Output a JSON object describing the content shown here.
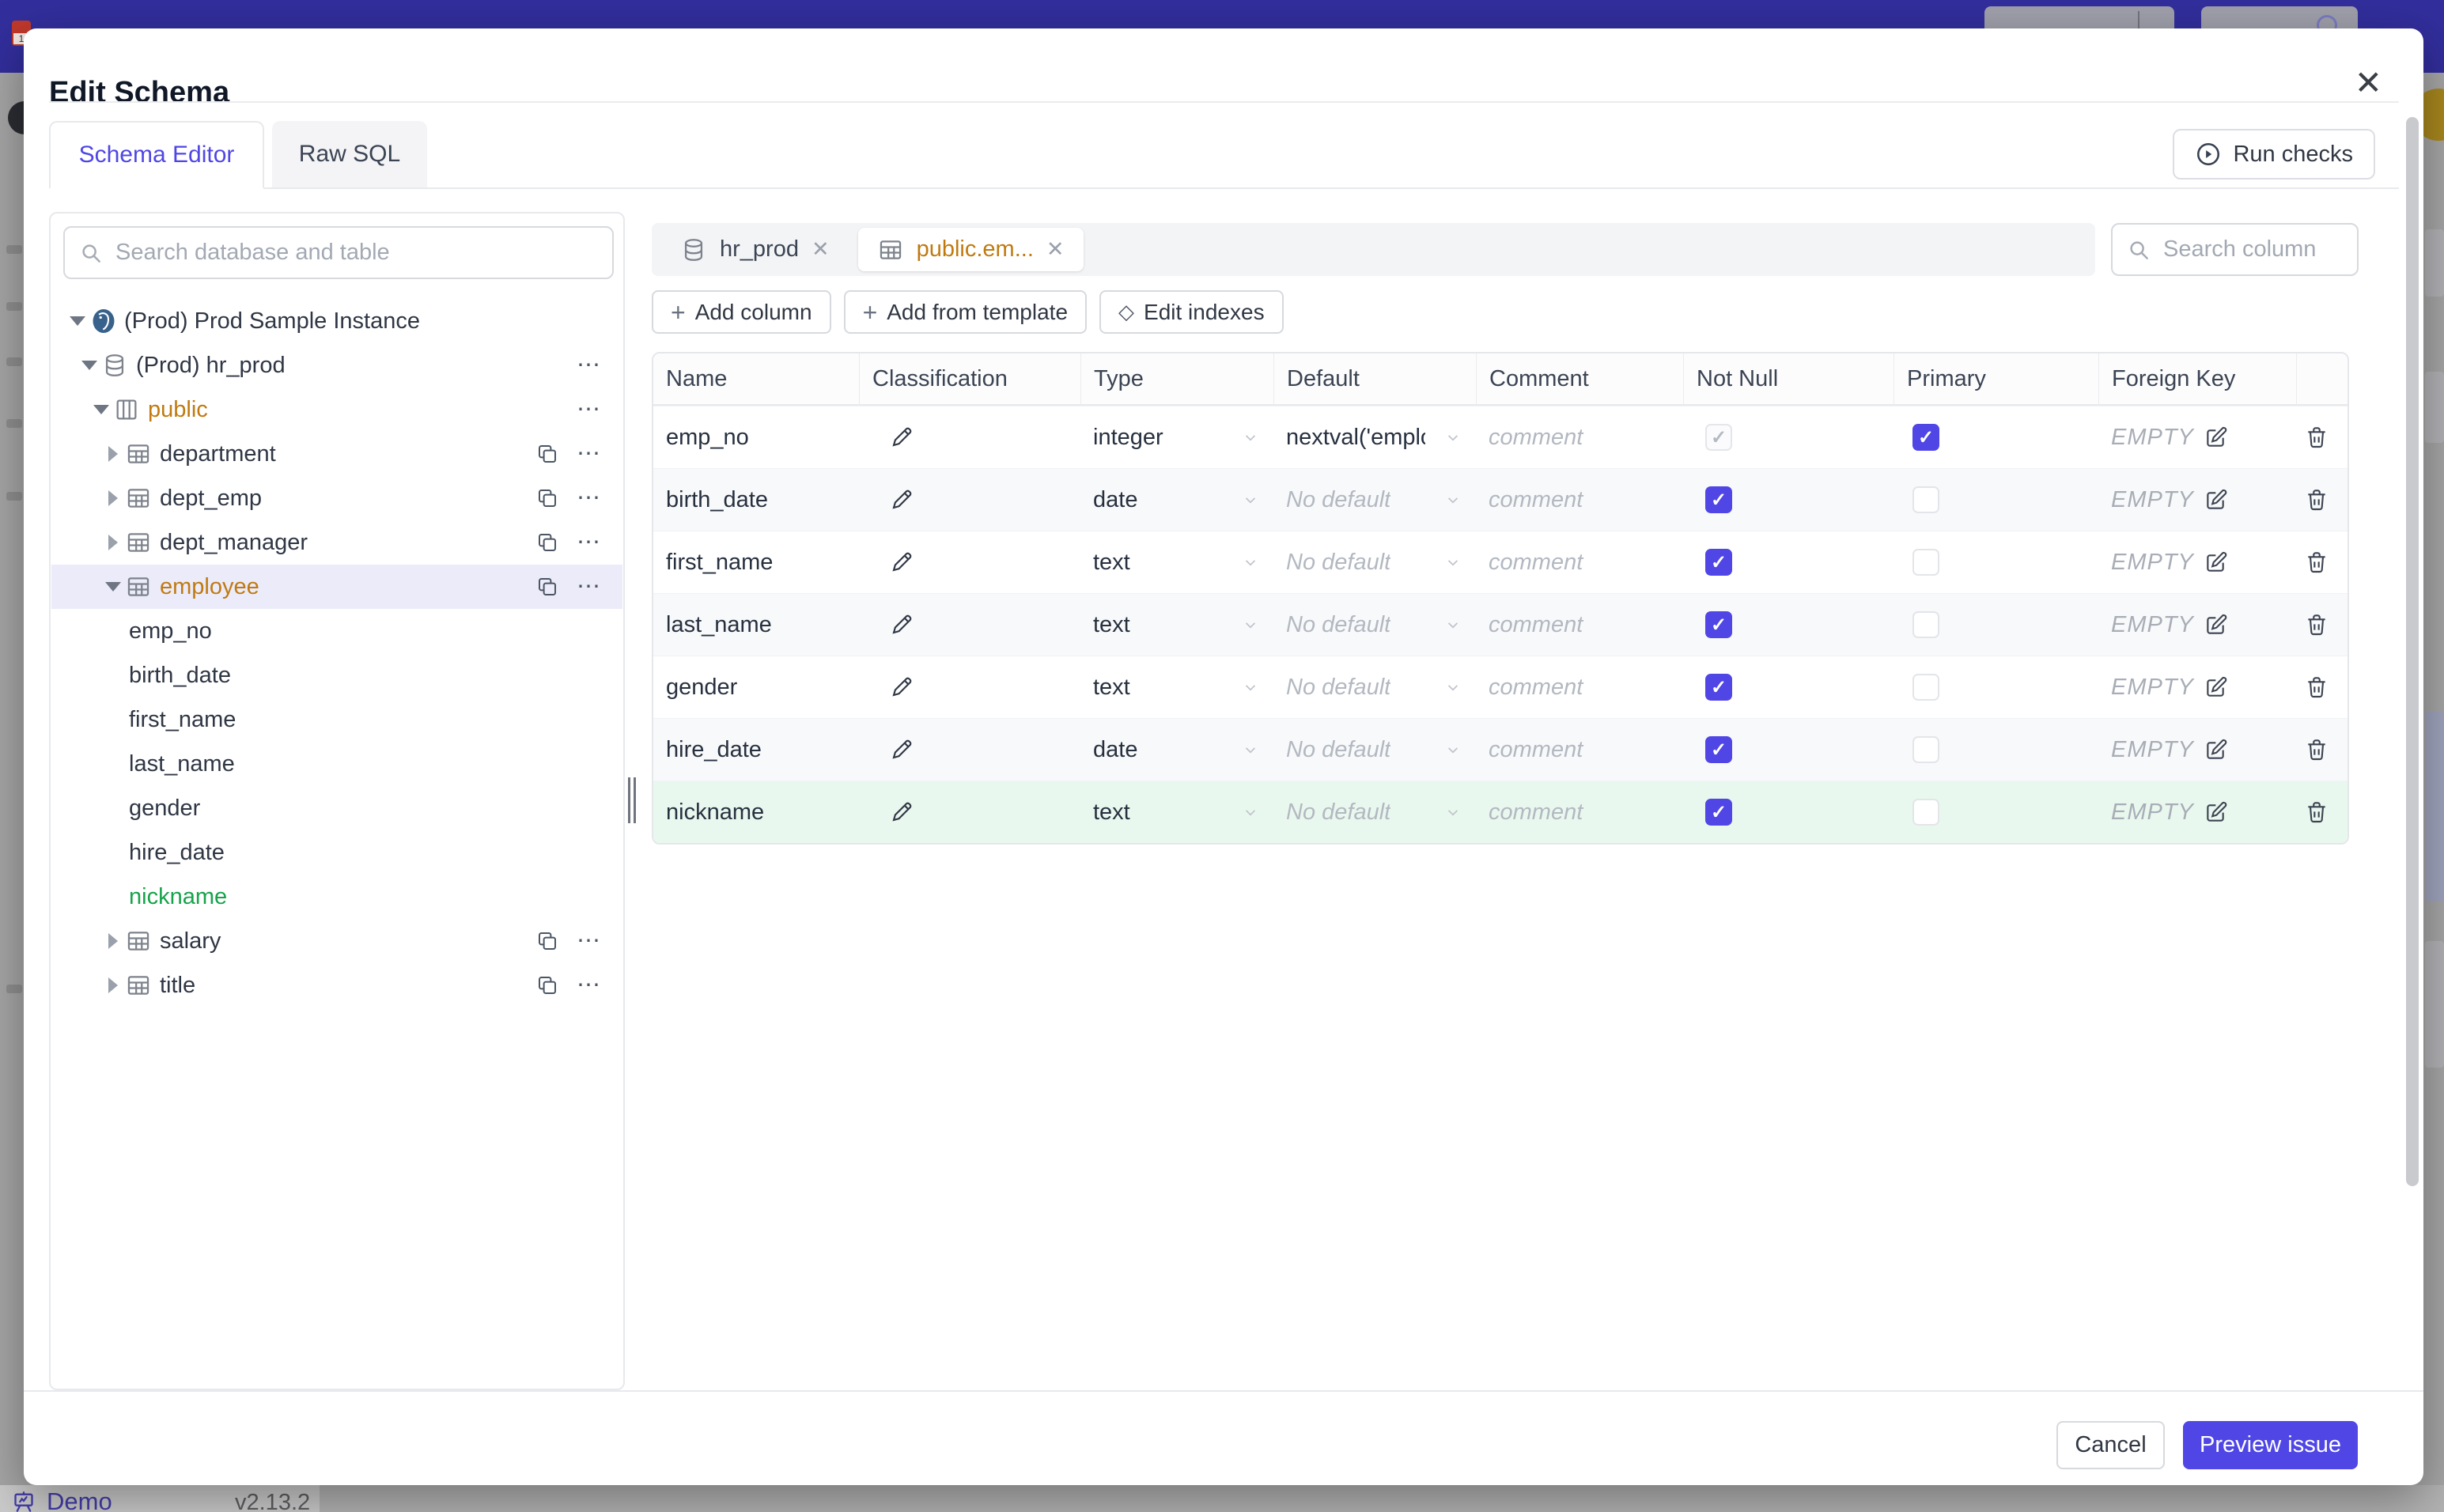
{
  "backdrop": {
    "footer": {
      "demo_label": "Demo",
      "version": "v2.13.2"
    }
  },
  "modal": {
    "title": "Edit Schema",
    "close_icon": "✕",
    "tabs": [
      {
        "label": "Schema Editor",
        "active": true
      },
      {
        "label": "Raw SQL",
        "active": false
      }
    ],
    "run_checks_label": "Run checks"
  },
  "sidebar": {
    "search_placeholder": "Search database and table",
    "tree": [
      {
        "level": 0,
        "label": "(Prod) Prod Sample Instance",
        "icon": "postgresql",
        "expanded": true,
        "actions": []
      },
      {
        "level": 1,
        "label": "(Prod) hr_prod",
        "icon": "database",
        "expanded": true,
        "actions": [
          "more"
        ]
      },
      {
        "level": 2,
        "label": "public",
        "icon": "schema",
        "expanded": true,
        "color": "amber",
        "actions": [
          "more"
        ]
      },
      {
        "level": 3,
        "label": "department",
        "icon": "table",
        "expanded": false,
        "actions": [
          "copy",
          "more"
        ]
      },
      {
        "level": 3,
        "label": "dept_emp",
        "icon": "table",
        "expanded": false,
        "actions": [
          "copy",
          "more"
        ]
      },
      {
        "level": 3,
        "label": "dept_manager",
        "icon": "table",
        "expanded": false,
        "actions": [
          "copy",
          "more"
        ]
      },
      {
        "level": 3,
        "label": "employee",
        "icon": "table",
        "expanded": true,
        "selected": true,
        "color": "amber",
        "actions": [
          "copy",
          "more"
        ]
      },
      {
        "level": 4,
        "label": "emp_no",
        "leaf": true
      },
      {
        "level": 4,
        "label": "birth_date",
        "leaf": true
      },
      {
        "level": 4,
        "label": "first_name",
        "leaf": true
      },
      {
        "level": 4,
        "label": "last_name",
        "leaf": true
      },
      {
        "level": 4,
        "label": "gender",
        "leaf": true
      },
      {
        "level": 4,
        "label": "hire_date",
        "leaf": true
      },
      {
        "level": 4,
        "label": "nickname",
        "leaf": true,
        "color": "green"
      },
      {
        "level": 3,
        "label": "salary",
        "icon": "table",
        "expanded": false,
        "actions": [
          "copy",
          "more"
        ]
      },
      {
        "level": 3,
        "label": "title",
        "icon": "table",
        "expanded": false,
        "actions": [
          "copy",
          "more"
        ]
      }
    ]
  },
  "main": {
    "tabs": [
      {
        "label": "hr_prod",
        "icon": "database",
        "active": false
      },
      {
        "label": "public.em...",
        "icon": "table",
        "active": true
      }
    ],
    "toolbar": [
      {
        "label": "Add column",
        "icon": "plus"
      },
      {
        "label": "Add from template",
        "icon": "plus"
      },
      {
        "label": "Edit indexes",
        "icon": "diamond"
      }
    ],
    "search_placeholder": "Search column",
    "table": {
      "headers": [
        "Name",
        "Classification",
        "Type",
        "Default",
        "Comment",
        "Not Null",
        "Primary",
        "Foreign Key",
        ""
      ],
      "comment_placeholder": "comment",
      "foreign_key_empty": "EMPTY",
      "rows": [
        {
          "name": "emp_no",
          "type": "integer",
          "default": "nextval('employ",
          "default_is_placeholder": false,
          "not_null": true,
          "not_null_disabled": true,
          "primary": true,
          "new": false
        },
        {
          "name": "birth_date",
          "type": "date",
          "default": "No default",
          "default_is_placeholder": true,
          "not_null": true,
          "not_null_disabled": false,
          "primary": false,
          "new": false
        },
        {
          "name": "first_name",
          "type": "text",
          "default": "No default",
          "default_is_placeholder": true,
          "not_null": true,
          "not_null_disabled": false,
          "primary": false,
          "new": false
        },
        {
          "name": "last_name",
          "type": "text",
          "default": "No default",
          "default_is_placeholder": true,
          "not_null": true,
          "not_null_disabled": false,
          "primary": false,
          "new": false
        },
        {
          "name": "gender",
          "type": "text",
          "default": "No default",
          "default_is_placeholder": true,
          "not_null": true,
          "not_null_disabled": false,
          "primary": false,
          "new": false
        },
        {
          "name": "hire_date",
          "type": "date",
          "default": "No default",
          "default_is_placeholder": true,
          "not_null": true,
          "not_null_disabled": false,
          "primary": false,
          "new": false
        },
        {
          "name": "nickname",
          "type": "text",
          "default": "No default",
          "default_is_placeholder": true,
          "not_null": true,
          "not_null_disabled": false,
          "primary": false,
          "new": true
        }
      ]
    }
  },
  "footer": {
    "cancel_label": "Cancel",
    "primary_label": "Preview issue"
  },
  "colors": {
    "indigo": "#4f46e5",
    "amber": "#c07a10",
    "green": "#16a34a",
    "topbar": "#322e9c",
    "selected_tree_row": "#ebebfa",
    "new_row_bg": "#e9f8ee"
  }
}
